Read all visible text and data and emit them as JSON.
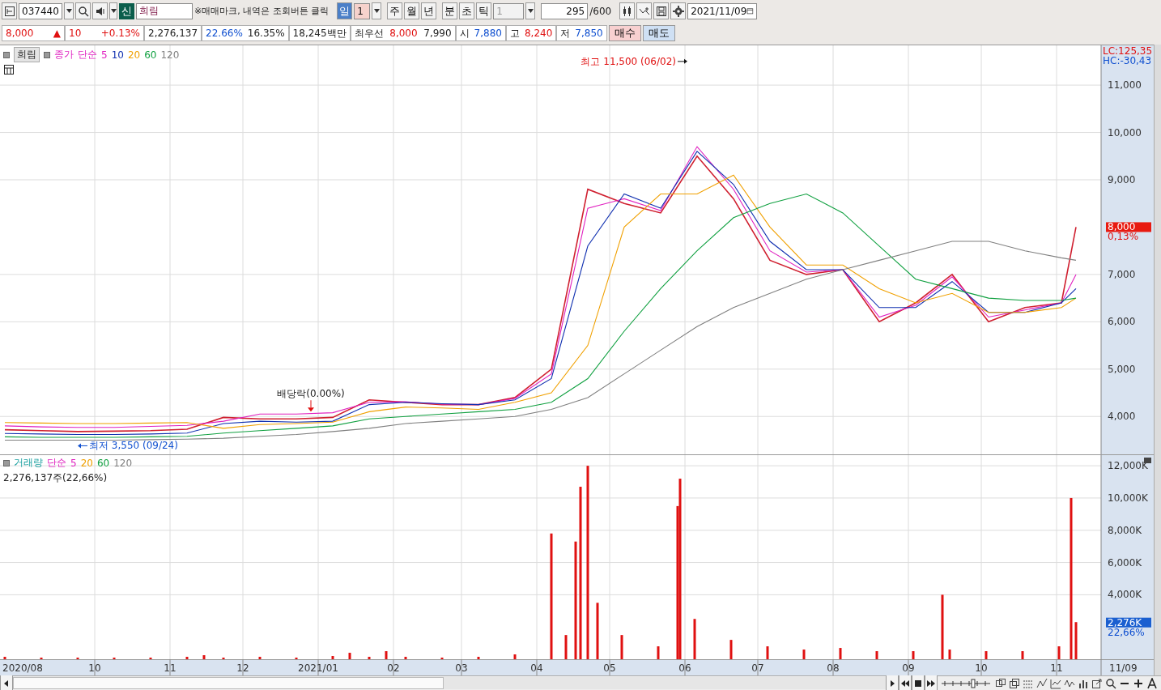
{
  "toolbar": {
    "code": "037440",
    "market_badge": "신",
    "stock_name": "희림",
    "notice": "※매매마크, 내역은 조회버튼 클릭",
    "periods": [
      {
        "label": "일",
        "selected": true
      },
      {
        "label": "주",
        "selected": false
      },
      {
        "label": "월",
        "selected": false
      },
      {
        "label": "년",
        "selected": false
      },
      {
        "label": "분",
        "selected": false
      },
      {
        "label": "초",
        "selected": false
      },
      {
        "label": "틱",
        "selected": false
      }
    ],
    "period_count": "1",
    "unit_count": "1",
    "display_count": "295",
    "display_max": "/600",
    "date": "2021/11/09"
  },
  "quote": {
    "price": "8,000",
    "direction": "▲",
    "change": "10",
    "change_rate": "+0.13%",
    "volume": "2,276,137",
    "volume_rate": "22.66%",
    "turnover": "16.35%",
    "amount": "18,245백만",
    "best_label": "최우선",
    "best_ask": "8,000",
    "best_bid": "7,990",
    "open_label": "시",
    "open": "7,880",
    "high_label": "고",
    "high": "8,240",
    "low_label": "저",
    "low": "7,850",
    "buy_button": "매수",
    "sell_button": "매도"
  },
  "price_panel": {
    "title": "희림",
    "legend_label": "단순",
    "lc": "LC:125,35",
    "hc": "HC:-30,43",
    "last_price": "8,000",
    "last_rate": "0,13%",
    "chart_data": {
      "type": "line",
      "grid": true,
      "xlim": [
        "2020-08-23",
        "2021-12-11"
      ],
      "x": [
        "2020-08-25",
        "2020-09-09",
        "2020-09-24",
        "2020-10-09",
        "2020-10-24",
        "2020-11-08",
        "2020-11-23",
        "2020-12-08",
        "2020-12-23",
        "2021-01-07",
        "2021-01-22",
        "2021-02-06",
        "2021-02-21",
        "2021-03-08",
        "2021-03-23",
        "2021-04-07",
        "2021-04-22",
        "2021-05-07",
        "2021-05-22",
        "2021-06-06",
        "2021-06-21",
        "2021-07-06",
        "2021-07-21",
        "2021-08-05",
        "2021-08-20",
        "2021-09-04",
        "2021-09-19",
        "2021-10-04",
        "2021-10-19",
        "2021-11-03",
        "2021-11-09"
      ],
      "series": [
        {
          "name": "종가",
          "color": "#d02030",
          "values": [
            3720,
            3700,
            3680,
            3690,
            3700,
            3730,
            3980,
            3950,
            3950,
            3980,
            4350,
            4300,
            4250,
            4250,
            4400,
            5000,
            8800,
            8500,
            8300,
            9500,
            8600,
            7300,
            7000,
            7100,
            6000,
            6400,
            7000,
            6000,
            6300,
            6400,
            8000
          ]
        },
        {
          "name": "5",
          "color": "#e020c0",
          "values": [
            3800,
            3780,
            3770,
            3770,
            3790,
            3810,
            3900,
            4050,
            4050,
            4080,
            4300,
            4310,
            4260,
            4250,
            4380,
            4900,
            8400,
            8600,
            8350,
            9700,
            8800,
            7500,
            7050,
            7100,
            6100,
            6350,
            6950,
            6100,
            6250,
            6400,
            7000
          ]
        },
        {
          "name": "10",
          "color": "#1030b0",
          "values": [
            3640,
            3630,
            3620,
            3620,
            3630,
            3650,
            3850,
            3900,
            3880,
            3900,
            4250,
            4300,
            4270,
            4250,
            4350,
            4800,
            7600,
            8700,
            8400,
            9600,
            8900,
            7700,
            7100,
            7100,
            6300,
            6300,
            6850,
            6200,
            6200,
            6400,
            6700
          ]
        },
        {
          "name": "20",
          "color": "#f0a000",
          "values": [
            3870,
            3860,
            3850,
            3850,
            3860,
            3870,
            3750,
            3830,
            3850,
            3880,
            4100,
            4200,
            4180,
            4150,
            4300,
            4500,
            5500,
            8000,
            8700,
            8700,
            9100,
            8000,
            7200,
            7200,
            6700,
            6400,
            6600,
            6200,
            6200,
            6300,
            6500
          ]
        },
        {
          "name": "60",
          "color": "#10a040",
          "values": [
            3570,
            3560,
            3560,
            3560,
            3570,
            3580,
            3650,
            3700,
            3750,
            3800,
            3950,
            4000,
            4050,
            4100,
            4150,
            4300,
            4800,
            5800,
            6700,
            7500,
            8200,
            8500,
            8700,
            8300,
            7600,
            6900,
            6700,
            6500,
            6450,
            6450,
            6500
          ]
        },
        {
          "name": "120",
          "color": "#808080",
          "values": [
            3500,
            3500,
            3500,
            3500,
            3510,
            3520,
            3540,
            3580,
            3620,
            3680,
            3750,
            3850,
            3900,
            3950,
            4000,
            4150,
            4400,
            4900,
            5400,
            5900,
            6300,
            6600,
            6900,
            7100,
            7300,
            7500,
            7700,
            7700,
            7500,
            7350,
            7300
          ]
        }
      ],
      "ylim": [
        3200,
        11840
      ],
      "yticks": [
        {
          "value": 4000,
          "label": "4,000"
        },
        {
          "value": 5000,
          "label": "5,000"
        },
        {
          "value": 6000,
          "label": "6,000"
        },
        {
          "value": 7000,
          "label": "7,000"
        },
        {
          "value": 9000,
          "label": "9,000"
        },
        {
          "value": 10000,
          "label": "10,000"
        },
        {
          "value": 11000,
          "label": "11,000"
        }
      ],
      "annotations": [
        "최고 11,500 (06/02)",
        "배당락(0.00%)",
        "최저 3,550 (09/24)"
      ]
    }
  },
  "volume_panel": {
    "legend_label": "단순",
    "ma": [
      {
        "label": "5",
        "color": "#e020c0"
      },
      {
        "label": "20",
        "color": "#f0a000"
      },
      {
        "label": "60",
        "color": "#10a040"
      },
      {
        "label": "120",
        "color": "#808080"
      }
    ],
    "summary": "2,276,137주(22,66%)",
    "last_volume": "2,276K",
    "last_rate": "22,66%",
    "chart_data": {
      "type": "bar",
      "grid": true,
      "xlim": [
        "2020-08-23",
        "2021-12-11"
      ],
      "x": [
        "2020-08-25",
        "2020-09-09",
        "2020-09-24",
        "2020-10-09",
        "2020-10-24",
        "2020-11-08",
        "2020-11-15",
        "2020-11-23",
        "2020-12-08",
        "2020-12-23",
        "2021-01-07",
        "2021-01-14",
        "2021-01-22",
        "2021-01-29",
        "2021-02-06",
        "2021-02-21",
        "2021-03-08",
        "2021-03-23",
        "2021-04-07",
        "2021-04-13",
        "2021-04-17",
        "2021-04-19",
        "2021-04-22",
        "2021-04-26",
        "2021-05-06",
        "2021-05-21",
        "2021-05-29",
        "2021-05-30",
        "2021-06-05",
        "2021-06-20",
        "2021-07-05",
        "2021-07-20",
        "2021-08-04",
        "2021-08-19",
        "2021-09-03",
        "2021-09-15",
        "2021-09-18",
        "2021-10-03",
        "2021-10-18",
        "2021-11-02",
        "2021-11-07",
        "2021-11-09"
      ],
      "series": [
        {
          "name": "거래량",
          "color": "#e01010",
          "values": [
            150,
            100,
            100,
            100,
            100,
            150,
            250,
            100,
            150,
            100,
            200,
            400,
            150,
            500,
            150,
            100,
            150,
            300,
            7800,
            1500,
            7300,
            10700,
            12000,
            3500,
            1500,
            800,
            9500,
            11200,
            2500,
            1200,
            800,
            600,
            700,
            500,
            500,
            4000,
            600,
            500,
            500,
            800,
            10000,
            2300
          ]
        }
      ],
      "ylim": [
        0,
        12660
      ],
      "yticks": [
        {
          "value": 4000,
          "label": "4,000K"
        },
        {
          "value": 6000,
          "label": "6,000K"
        },
        {
          "value": 8000,
          "label": "8,000K"
        },
        {
          "value": 10000,
          "label": "10,000K"
        },
        {
          "value": 12000,
          "label": "12,000K"
        }
      ],
      "xticks": [
        {
          "value": "2020-10-01",
          "label": "10"
        },
        {
          "value": "2020-11-01",
          "label": "11"
        },
        {
          "value": "2020-12-01",
          "label": "12"
        },
        {
          "value": "2021-01-01",
          "label": "2021/01"
        },
        {
          "value": "2021-02-01",
          "label": "02"
        },
        {
          "value": "2021-03-01",
          "label": "03"
        },
        {
          "value": "2021-04-01",
          "label": "04"
        },
        {
          "value": "2021-05-01",
          "label": "05"
        },
        {
          "value": "2021-06-01",
          "label": "06"
        },
        {
          "value": "2021-07-01",
          "label": "07"
        },
        {
          "value": "2021-08-01",
          "label": "08"
        },
        {
          "value": "2021-09-01",
          "label": "09"
        },
        {
          "value": "2021-10-01",
          "label": "10"
        },
        {
          "value": "2021-11-01",
          "label": "11"
        }
      ]
    }
  },
  "x_axis_start": "2020/08",
  "x_axis_end": "11/09"
}
